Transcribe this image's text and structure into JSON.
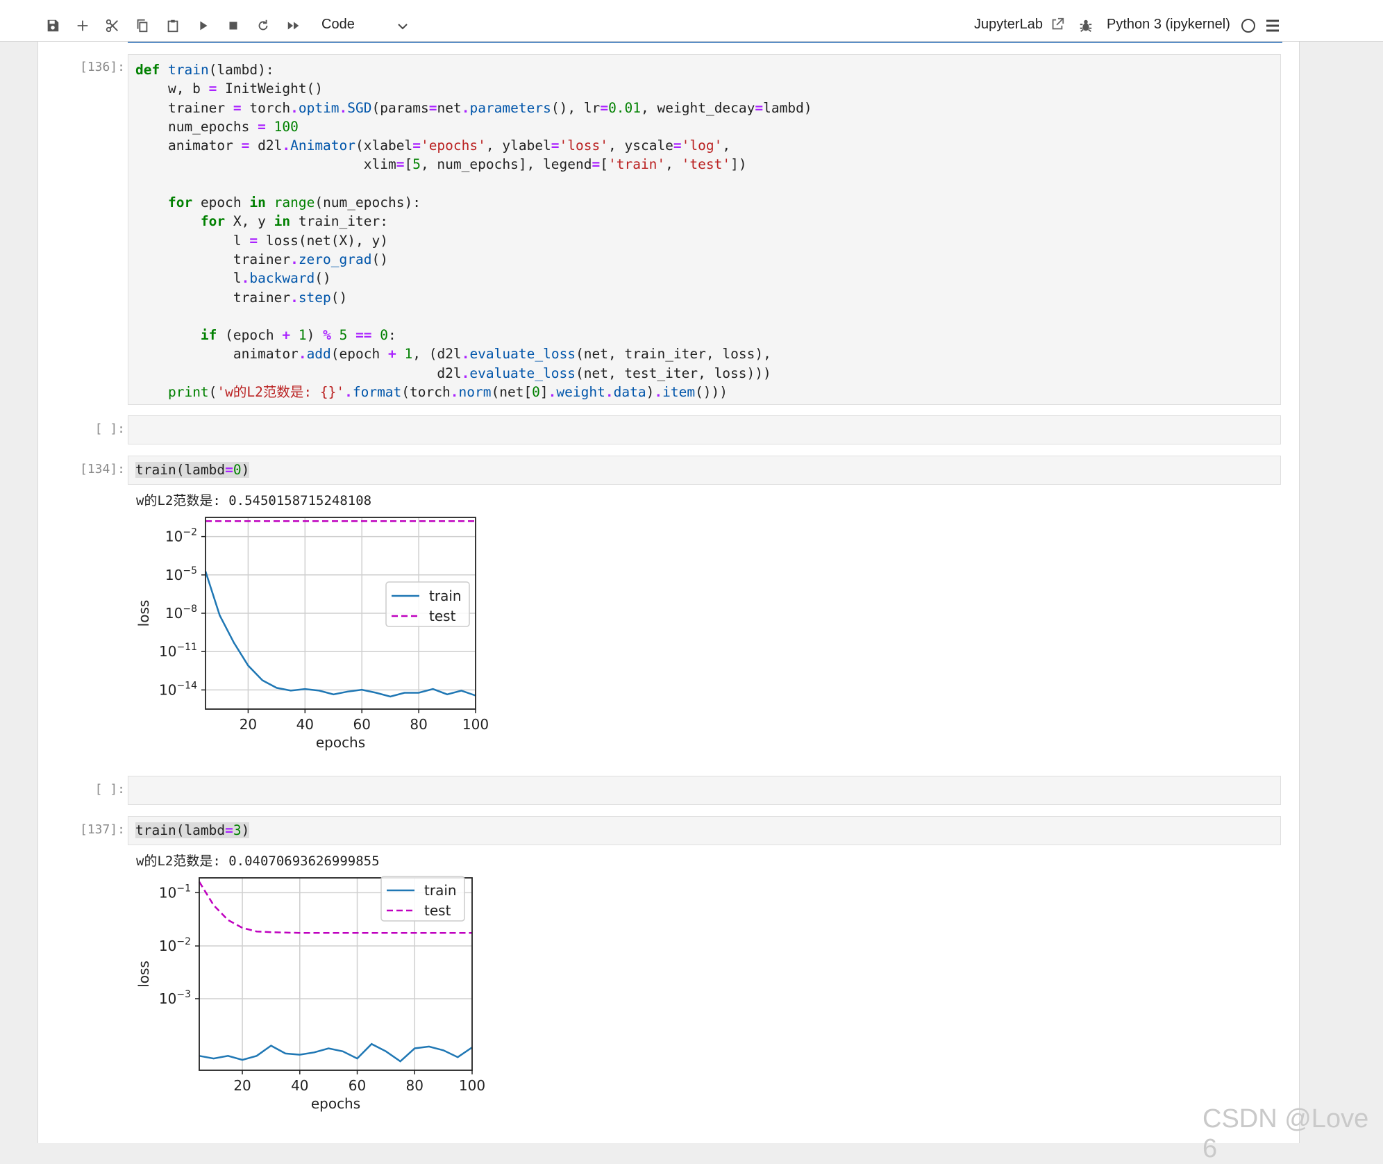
{
  "toolbar": {
    "cell_type": "Code",
    "jupyterlab_label": "JupyterLab",
    "kernel_label": "Python 3 (ipykernel)"
  },
  "cells": [
    {
      "prompt": "[136]:"
    },
    {
      "prompt": "[ ]:"
    },
    {
      "prompt": "[134]:",
      "output": "w的L2范数是: 0.5450158715248108"
    },
    {
      "prompt": "[ ]:"
    },
    {
      "prompt": "[137]:",
      "output": "w的L2范数是: 0.04070693626999855"
    }
  ],
  "chart_data": [
    {
      "type": "line",
      "xlabel": "epochs",
      "ylabel": "loss",
      "yscale": "log",
      "xlim": [
        5,
        100
      ],
      "ylim": [
        1e-16,
        0.2
      ],
      "grid": true,
      "legend_position": "center-right",
      "x_ticks": [
        "20",
        "40",
        "60",
        "80",
        "100"
      ],
      "y_ticks": [
        {
          "base": "10",
          "exp": "−2"
        },
        {
          "base": "10",
          "exp": "−5"
        },
        {
          "base": "10",
          "exp": "−8"
        },
        {
          "base": "10",
          "exp": "−11"
        },
        {
          "base": "10",
          "exp": "−14"
        }
      ],
      "x": [
        5,
        10,
        15,
        20,
        25,
        30,
        35,
        40,
        45,
        50,
        55,
        60,
        65,
        70,
        75,
        80,
        85,
        90,
        95,
        100
      ],
      "series": [
        {
          "name": "train",
          "color": "#1f77b4",
          "style": "solid",
          "values": [
            1e-05,
            3e-09,
            2e-11,
            3e-13,
            2e-14,
            5e-15,
            3e-15,
            4e-15,
            3e-15,
            1.5e-15,
            2.5e-15,
            3.5e-15,
            2e-15,
            1e-15,
            2e-15,
            2e-15,
            4e-15,
            1.5e-15,
            3e-15,
            1.2e-15
          ]
        },
        {
          "name": "test",
          "color": "#bf00bf",
          "style": "dashed",
          "values": [
            0.1,
            0.1,
            0.1,
            0.1,
            0.1,
            0.1,
            0.1,
            0.1,
            0.1,
            0.1,
            0.1,
            0.1,
            0.1,
            0.1,
            0.1,
            0.1,
            0.1,
            0.1,
            0.1,
            0.1
          ]
        }
      ]
    },
    {
      "type": "line",
      "xlabel": "epochs",
      "ylabel": "loss",
      "yscale": "log",
      "xlim": [
        5,
        100
      ],
      "ylim": [
        0.00013,
        0.15
      ],
      "grid": true,
      "legend_position": "top-right",
      "x_ticks": [
        "20",
        "40",
        "60",
        "80",
        "100"
      ],
      "y_ticks": [
        {
          "base": "10",
          "exp": "−1"
        },
        {
          "base": "10",
          "exp": "−2"
        },
        {
          "base": "10",
          "exp": "−3"
        }
      ],
      "x": [
        5,
        10,
        15,
        20,
        25,
        30,
        35,
        40,
        45,
        50,
        55,
        60,
        65,
        70,
        75,
        80,
        85,
        90,
        95,
        100
      ],
      "series": [
        {
          "name": "train",
          "color": "#1f77b4",
          "style": "solid",
          "values": [
            0.00022,
            0.0002,
            0.00022,
            0.00019,
            0.00022,
            0.00032,
            0.00024,
            0.00023,
            0.00025,
            0.00029,
            0.00026,
            0.0002,
            0.00034,
            0.00026,
            0.00018,
            0.00029,
            0.00031,
            0.00027,
            0.00021,
            0.0003
          ]
        },
        {
          "name": "test",
          "color": "#bf00bf",
          "style": "dashed",
          "values": [
            0.13,
            0.055,
            0.032,
            0.024,
            0.021,
            0.0205,
            0.0202,
            0.02,
            0.02,
            0.02,
            0.02,
            0.02,
            0.02,
            0.02,
            0.02,
            0.02,
            0.02,
            0.02,
            0.02,
            0.02
          ]
        }
      ]
    }
  ],
  "watermark": "CSDN @Love 6"
}
